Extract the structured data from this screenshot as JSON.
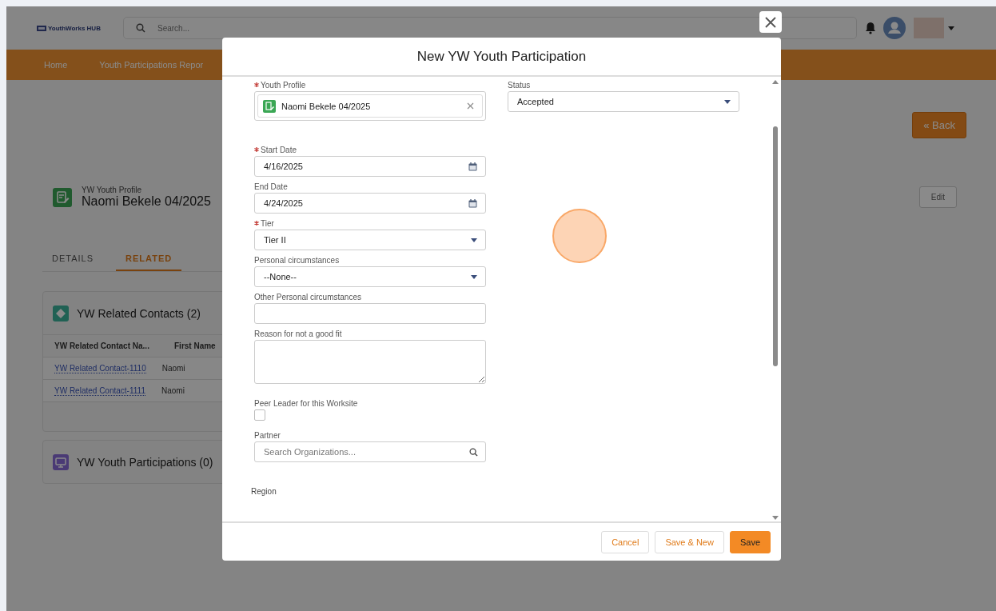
{
  "header": {
    "logo": "YouthWorks HUB",
    "search": {
      "placeholder": "Search..."
    }
  },
  "nav": [
    {
      "label": "Home"
    },
    {
      "label": "Youth Participations Repor"
    }
  ],
  "back_button": "« Back",
  "record": {
    "type": "YW Youth Profile",
    "name": "Naomi Bekele 04/2025",
    "edit_button": "Edit"
  },
  "tabs": [
    {
      "label": "DETAILS",
      "selected": false
    },
    {
      "label": "RELATED",
      "selected": true
    }
  ],
  "related_lists": [
    {
      "kind": "contacts",
      "title": "YW Related Contacts (2)",
      "columns": [
        "YW Related Contact Na...",
        "First Name"
      ],
      "rows": [
        [
          "YW Related Contact-1110",
          "Naomi"
        ],
        [
          "YW Related Contact-1111",
          "Naomi"
        ]
      ]
    },
    {
      "kind": "participations",
      "title": "YW Youth Participations (0)"
    }
  ],
  "modal": {
    "title": "New YW Youth Participation",
    "left_fields": [
      {
        "kind": "lookup",
        "label": "Youth Profile",
        "required": true,
        "value": "Naomi Bekele 04/2025"
      },
      {
        "kind": "date",
        "label": "Start Date",
        "required": true,
        "value": "4/16/2025"
      },
      {
        "kind": "date",
        "label": "End Date",
        "required": false,
        "value": "4/24/2025"
      },
      {
        "kind": "picklist",
        "label": "Tier",
        "required": true,
        "value": "Tier II"
      },
      {
        "kind": "picklist",
        "label": "Personal circumstances",
        "required": false,
        "value": "--None--"
      },
      {
        "kind": "text",
        "label": "Other Personal circumstances",
        "required": false
      },
      {
        "kind": "textarea",
        "label": "Reason for not a good fit",
        "required": false
      },
      {
        "kind": "checkbox",
        "label": "Peer Leader for this Worksite",
        "required": false,
        "checked": false
      },
      {
        "kind": "search",
        "label": "Partner",
        "required": false,
        "placeholder": "Search Organizations..."
      }
    ],
    "section_label": "Region",
    "right_fields": [
      {
        "kind": "picklist",
        "label": "Status",
        "required": false,
        "value": "Accepted"
      }
    ],
    "buttons": [
      {
        "kind": "neutral",
        "label": "Cancel"
      },
      {
        "kind": "neutral",
        "label": "Save & New"
      },
      {
        "kind": "brand",
        "label": "Save"
      }
    ]
  }
}
